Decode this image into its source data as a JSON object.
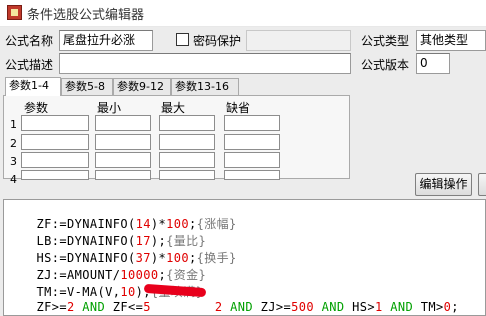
{
  "window": {
    "title": "条件选股公式编辑器"
  },
  "form": {
    "name_label": "公式名称",
    "name_value": "尾盘拉升必涨",
    "password_label": "密码保护",
    "password_checked": false,
    "password_value": "",
    "type_label": "公式类型",
    "type_value": "其他类型",
    "desc_label": "公式描述",
    "desc_value": "",
    "version_label": "公式版本",
    "version_value": "0"
  },
  "tabs": [
    "参数1-4",
    "参数5-8",
    "参数9-12",
    "参数13-16"
  ],
  "params": {
    "headers": [
      "参数",
      "最小",
      "最大",
      "缺省"
    ],
    "rows": [
      "1",
      "2",
      "3",
      "4"
    ]
  },
  "buttons": {
    "edit_ops": "编辑操作"
  },
  "code": {
    "line1": {
      "a": "ZF:=DYNAINFO(",
      "b": "14",
      "c": ")*",
      "d": "100",
      "e": ";",
      "f": "{涨幅}"
    },
    "line2": {
      "a": "LB:=DYNAINFO(",
      "b": "17",
      "c": ");",
      "d": "{量比}"
    },
    "line3": {
      "a": "HS:=DYNAINFO(",
      "b": "37",
      "c": ")*",
      "d": "100",
      "e": ";",
      "f": "{换手}"
    },
    "line4": {
      "a": "ZJ:=AMOUNT/",
      "b": "10000",
      "c": ";",
      "d": "{资金}"
    },
    "line5": {
      "a": "TM:=V-MA(V,",
      "b": "10",
      "c": ");",
      "d": "{量填满}"
    },
    "line6": {
      "a": "ZF>=",
      "b": "2",
      "c": " AND ",
      "d": "ZF<=",
      "e": "5",
      "f": "2",
      "g": " AND ",
      "h": "ZJ>=",
      "i": "500",
      "j": " AND ",
      "k": "HS>",
      "l": "1",
      "m": " AND ",
      "n": "TM>",
      "o": "0",
      "p": ";"
    }
  }
}
